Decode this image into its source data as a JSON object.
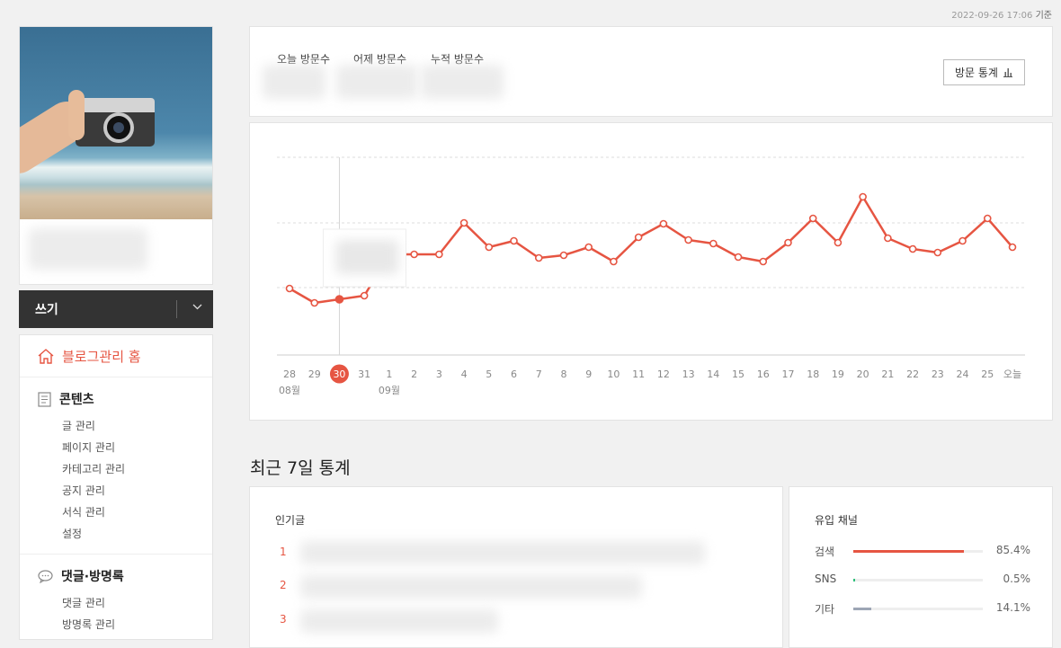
{
  "timestamp": {
    "date": "2022-09-26 17:06",
    "suffix": "기준"
  },
  "sidebar": {
    "write_label": "쓰기",
    "home_label": "블로그관리 홈",
    "contents": {
      "title": "콘텐츠",
      "items": [
        "글 관리",
        "페이지 관리",
        "카테고리 관리",
        "공지 관리",
        "서식 관리",
        "설정"
      ]
    },
    "comments": {
      "title": "댓글·방명록",
      "items": [
        "댓글 관리",
        "방명록 관리"
      ]
    }
  },
  "visits": {
    "today_label": "오늘 방문수",
    "yesterday_label": "어제 방문수",
    "total_label": "누적 방문수",
    "button_label": "방문 통계"
  },
  "chart_data": {
    "type": "line",
    "x": [
      "28",
      "29",
      "30",
      "31",
      "1",
      "2",
      "3",
      "4",
      "5",
      "6",
      "7",
      "8",
      "9",
      "10",
      "11",
      "12",
      "13",
      "14",
      "15",
      "16",
      "17",
      "18",
      "19",
      "20",
      "21",
      "22",
      "23",
      "24",
      "25",
      "오늘"
    ],
    "month_labels": [
      {
        "at": "28",
        "label": "08월"
      },
      {
        "at": "1",
        "label": "09월"
      }
    ],
    "values": [
      7.4,
      5.8,
      6.2,
      6.6,
      11.2,
      11.2,
      11.2,
      14.7,
      12.0,
      12.7,
      10.8,
      11.1,
      12.0,
      10.4,
      13.1,
      14.6,
      12.8,
      12.4,
      10.9,
      10.4,
      12.5,
      15.2,
      12.5,
      17.6,
      13.0,
      11.8,
      11.4,
      12.7,
      15.2,
      12.0
    ],
    "ylim": [
      0,
      22
    ],
    "gridlines": [
      7.5,
      14.7,
      22
    ],
    "highlighted": "30",
    "color": "#e65542",
    "grid": true
  },
  "recent": {
    "title": "최근 7일 통계",
    "popular_title": "인기글",
    "ranks": [
      "1",
      "2",
      "3"
    ],
    "channel_title": "유입 채널",
    "channels": [
      {
        "label": "검색",
        "percent": "85.4%",
        "value": 85.4,
        "color": "#e65542"
      },
      {
        "label": "SNS",
        "percent": "0.5%",
        "value": 0.5,
        "color": "#2dbf7a"
      },
      {
        "label": "기타",
        "percent": "14.1%",
        "value": 14.1,
        "color": "#9da6b5"
      }
    ]
  }
}
